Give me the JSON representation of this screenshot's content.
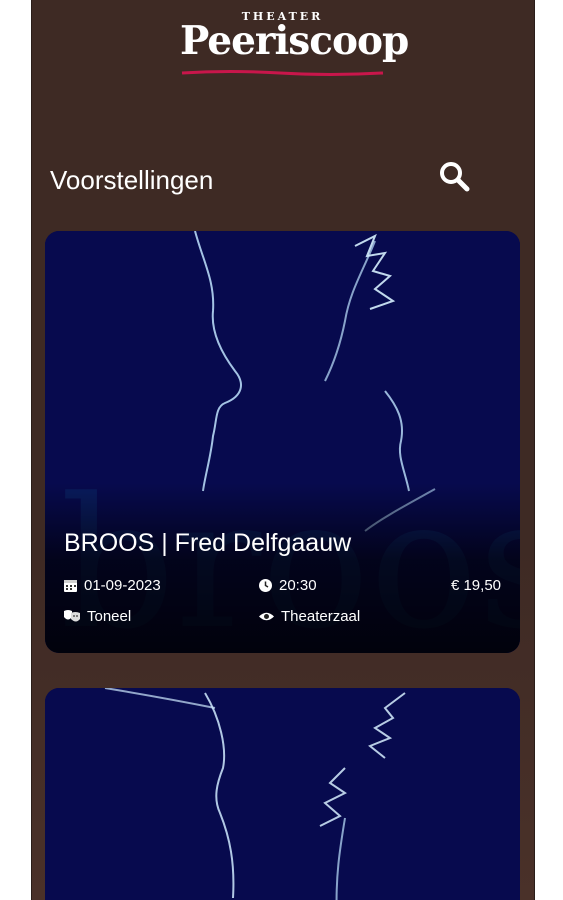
{
  "logo": {
    "top_text": "THEATER",
    "name": "Peeriscoop"
  },
  "header": {
    "title": "Voorstellingen",
    "search_icon": "search-icon"
  },
  "colors": {
    "background": "#3e2a24",
    "card": "#070a4e",
    "accent": "#c8164b"
  },
  "events": [
    {
      "title": "BROOS | Fred Delfgaauw",
      "date": "01-09-2023",
      "time": "20:30",
      "price": "€ 19,50",
      "genre": "Toneel",
      "venue": "Theaterzaal",
      "artwork_text": "broos"
    }
  ]
}
